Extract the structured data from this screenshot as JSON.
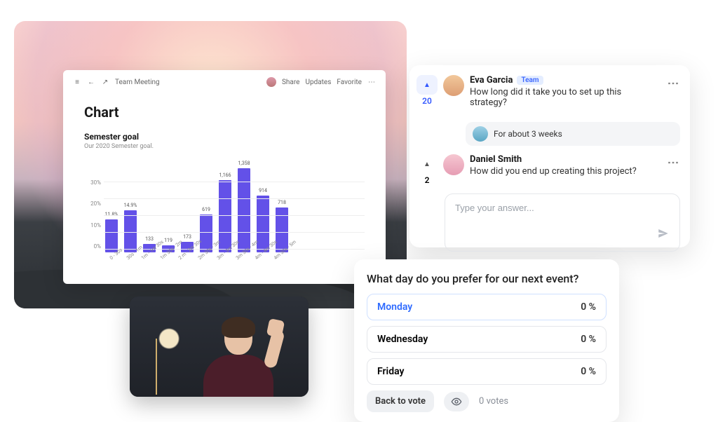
{
  "backdrop": {
    "alt": "sunset-mountains"
  },
  "doc": {
    "breadcrumb": "Team Meeting",
    "share": "Share",
    "updates": "Updates",
    "favorite": "Favorite",
    "title": "Chart",
    "chart_heading": "Semester goal",
    "chart_sub": "Our 2020 Semester goal."
  },
  "chart_data": {
    "type": "bar",
    "title": "Semester goal",
    "subtitle": "Our 2020 Semester goal.",
    "xlabel": "",
    "ylabel": "",
    "ylim": [
      0,
      30
    ],
    "y_ticks": [
      "30%",
      "20%",
      "10%",
      "0%"
    ],
    "categories": [
      "0 - 30s",
      "30s - 1m",
      "1m - 1m 30s",
      "1m 30s - 2m",
      "2 m - 2m 30s",
      "2m 30s - 3m",
      "3m - 3m 30s",
      "3m 30s - 4m",
      "4m - 4m 30s",
      "4m 30s - 5m"
    ],
    "value_labels": [
      "11.8%",
      "14.9%",
      "133",
      "119",
      "173",
      "619",
      "1,166",
      "1,358",
      "914",
      "718"
    ],
    "values_for_height": [
      11.8,
      14.9,
      2.9,
      2.6,
      3.8,
      13.6,
      25.7,
      30.0,
      20.2,
      15.9
    ],
    "color": "#6351e8"
  },
  "qa": {
    "q1": {
      "votes": "20",
      "name": "Eva Garcia",
      "tag": "Team",
      "text": "How long did it take you to set up this strategy?",
      "reply": "For about 3 weeks"
    },
    "q2": {
      "votes": "2",
      "name": "Daniel Smith",
      "text": "How did you end up creating this project?"
    },
    "answer_placeholder": "Type your answer..."
  },
  "poll": {
    "question": "What day do you prefer for our next event?",
    "options": [
      {
        "label": "Monday",
        "pct": "0 %",
        "selected": true
      },
      {
        "label": "Wednesday",
        "pct": "0 %",
        "selected": false
      },
      {
        "label": "Friday",
        "pct": "0 %",
        "selected": false
      }
    ],
    "back": "Back to vote",
    "votes": "0 votes"
  }
}
